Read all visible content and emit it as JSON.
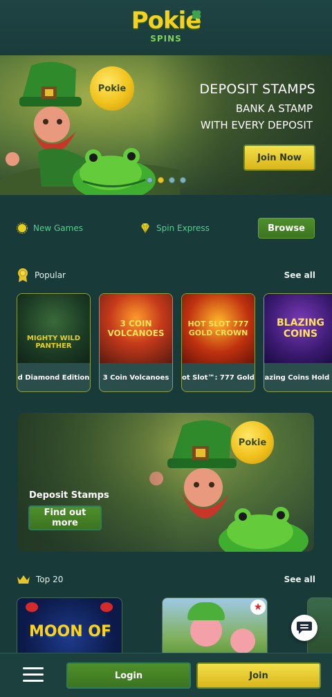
{
  "brand": {
    "logo_text": "Pokie",
    "logo_sub": "SPINS",
    "colors": {
      "primary_yellow": "#f3d62a",
      "green": "#3f7d22",
      "bg": "#183a39",
      "accent_text": "#4fd38b"
    }
  },
  "hero": {
    "title": "DEPOSIT STAMPS",
    "line1": "BANK A STAMP",
    "line2": "WITH EVERY DEPOSIT",
    "cta": "Join Now",
    "coin_text": "Pokie",
    "slides": 4,
    "active_slide": 2
  },
  "quicknav": {
    "new_games": {
      "label": "New Games",
      "icon": "sun-icon"
    },
    "spin_express": {
      "label": "Spin Express",
      "icon": "diamond-icon"
    },
    "browse": "Browse"
  },
  "popular": {
    "title": "Popular",
    "icon": "award-icon",
    "see_all": "See all",
    "games": [
      {
        "name": "d Diamond Edition",
        "art": "MIGHTY WILD PANTHER"
      },
      {
        "name": "3 Coin Volcanoes",
        "art": "3 COIN VOLCANOES"
      },
      {
        "name": "ot Slot™: 777 Gold",
        "art": "HOT SLOT 777 GOLD CROWN"
      },
      {
        "name": "azing Coins Hold a",
        "art": "BLAZING COINS"
      }
    ]
  },
  "promo": {
    "title": "Deposit Stamps",
    "cta": "Find out more",
    "coin_text": "Pokie"
  },
  "top20": {
    "title": "Top 20",
    "icon": "crown-icon",
    "see_all": "See all",
    "games": [
      {
        "art": "MOON OF"
      },
      {
        "art": ""
      },
      {
        "art": ""
      }
    ]
  },
  "bottom_bar": {
    "login": "Login",
    "join": "Join",
    "menu_icon": "hamburger-menu-icon",
    "chat_icon": "chat-icon"
  }
}
